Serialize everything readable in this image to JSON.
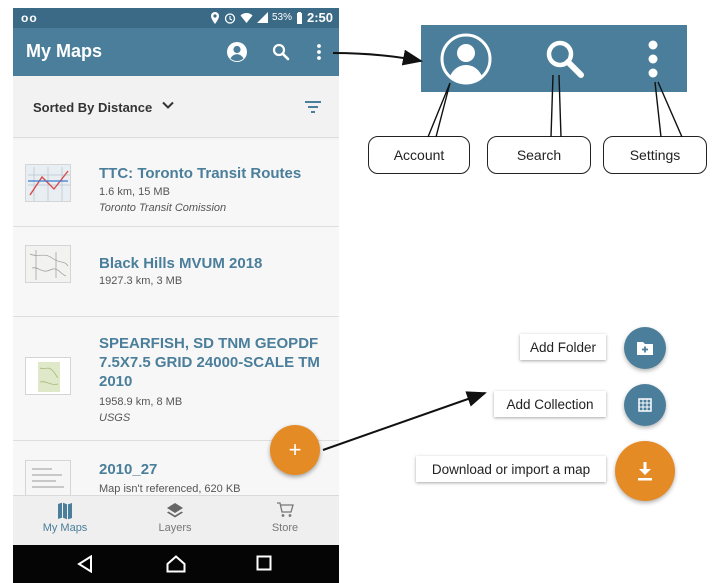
{
  "statusbar": {
    "carrier_glyph": "oo",
    "battery": "53%",
    "time": "2:50"
  },
  "appbar": {
    "title": "My Maps"
  },
  "sort": {
    "label": "Sorted By Distance"
  },
  "maps": [
    {
      "title": "TTC: Toronto Transit Routes",
      "meta": "1.6 km, 15 MB",
      "source": "Toronto Transit Comission"
    },
    {
      "title": "Black Hills MVUM 2018",
      "meta": "1927.3 km, 3 MB",
      "source": ""
    },
    {
      "title": "SPEARFISH, SD TNM GEOPDF 7.5X7.5 GRID 24000-SCALE TM 2010",
      "meta": "1958.9 km, 8 MB",
      "source": "USGS"
    },
    {
      "title": "2010_27",
      "meta": "Map isn't referenced, 620 KB",
      "source": ""
    }
  ],
  "fab": {
    "label": "+"
  },
  "bottom_nav": [
    {
      "label": "My Maps",
      "icon": "map-icon",
      "active": true
    },
    {
      "label": "Layers",
      "icon": "layers-icon",
      "active": false
    },
    {
      "label": "Store",
      "icon": "cart-icon",
      "active": false
    }
  ],
  "callouts": {
    "account": "Account",
    "search": "Search",
    "settings": "Settings"
  },
  "fab_menu": {
    "add_folder": "Add Folder",
    "add_collection": "Add Collection",
    "download_import": "Download or import a map"
  },
  "colors": {
    "primary": "#4a7e9a",
    "accent": "#e58b25",
    "statusbar": "#3a6a86"
  }
}
